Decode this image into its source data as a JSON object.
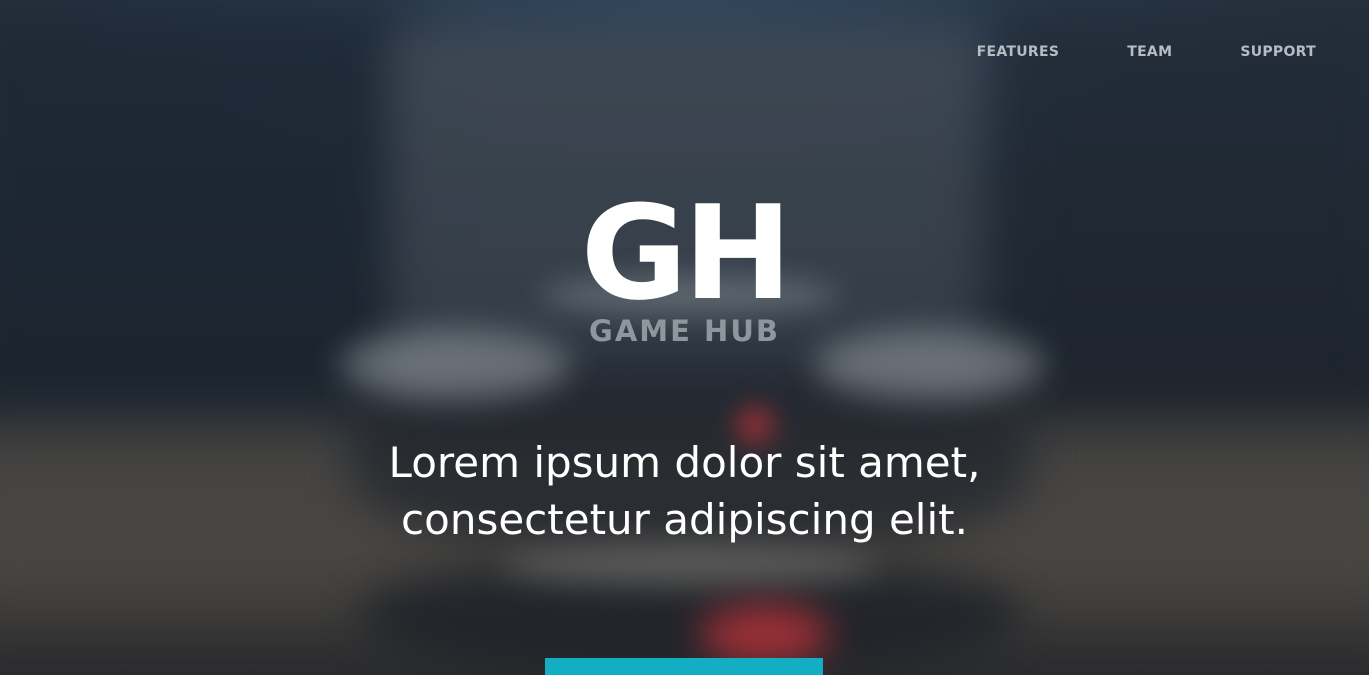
{
  "nav": {
    "items": [
      {
        "label": "FEATURES"
      },
      {
        "label": "TEAM"
      },
      {
        "label": "SUPPORT"
      }
    ]
  },
  "logo": {
    "mark": "GH",
    "name": "GAME HUB"
  },
  "hero": {
    "tagline_line1": "Lorem ipsum dolor sit amet,",
    "tagline_line2": "consectetur adipiscing elit."
  },
  "colors": {
    "accent": "#14aec4",
    "nav_text": "#b6bcc4",
    "logo_name": "#8f969e",
    "text": "#ffffff"
  }
}
